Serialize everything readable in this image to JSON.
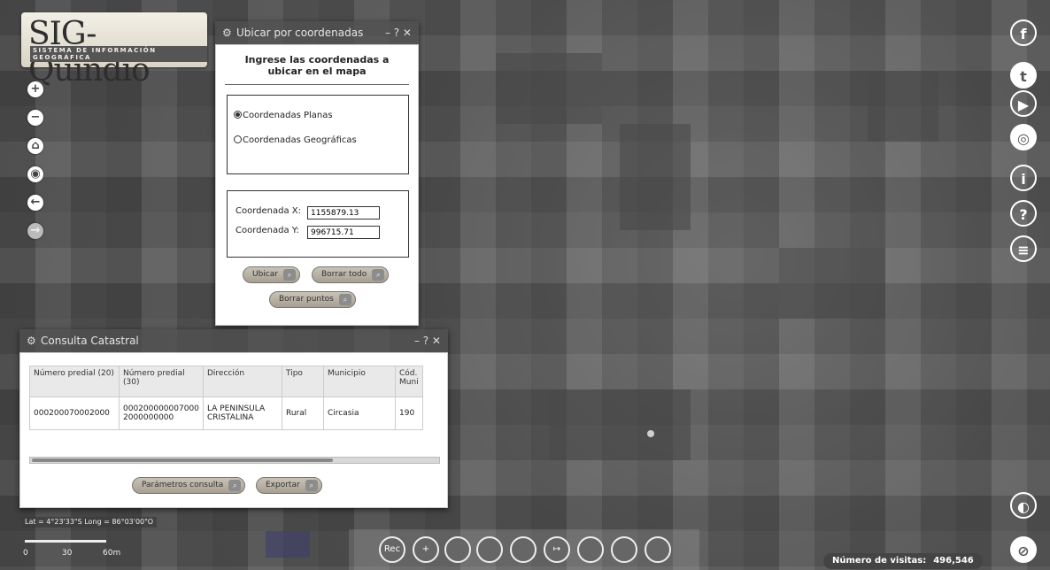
{
  "logo": {
    "name": "SIG-Quindío",
    "tagline": "SISTEMA DE INFORMACIÓN GEOGRÁFICA"
  },
  "nav": {
    "zoom_in": "+",
    "zoom_out": "−",
    "home": "⌂",
    "locate": "◉",
    "back": "←",
    "forward": "→"
  },
  "coord_dialog": {
    "title": "Ubicar por coordenadas",
    "window_controls": "– ? ✕",
    "heading": "Ingrese las coordenadas a ubicar en el mapa",
    "options": [
      {
        "label": "Coordenadas Planas",
        "selected": true
      },
      {
        "label": "Coordenadas Geográficas",
        "selected": false
      }
    ],
    "x_label": "Coordenada X:",
    "x_value": "1155879.13",
    "y_label": "Coordenada Y:",
    "y_value": "996715.71",
    "buttons": {
      "locate": "Ubicar",
      "clear_all": "Borrar todo",
      "clear_points": "Borrar puntos"
    }
  },
  "cadastral": {
    "title": "Consulta Catastral",
    "window_controls": "– ? ✕",
    "columns": [
      "Número predial (20)",
      "Número predial (30)",
      "Dirección",
      "Tipo",
      "Municipio",
      "Cód. Muni"
    ],
    "rows": [
      [
        "000200070002000",
        "000200000007000 2000000000",
        "LA PENINSULA CRISTALINA",
        "Rural",
        "Circasia",
        "190"
      ]
    ],
    "buttons": {
      "params": "Parámetros consulta",
      "export": "Exportar"
    }
  },
  "coords_readout": "Lat = 4°23'33\"S Long = 86°03'00\"O",
  "scale": {
    "zero": "0",
    "mid": "30",
    "end": "60m"
  },
  "toolbar": {
    "items": [
      "Rec",
      "+",
      "",
      "",
      "",
      "↦",
      "",
      "",
      ""
    ]
  },
  "visits": {
    "label": "Número de visitas:",
    "count": "496,546"
  }
}
